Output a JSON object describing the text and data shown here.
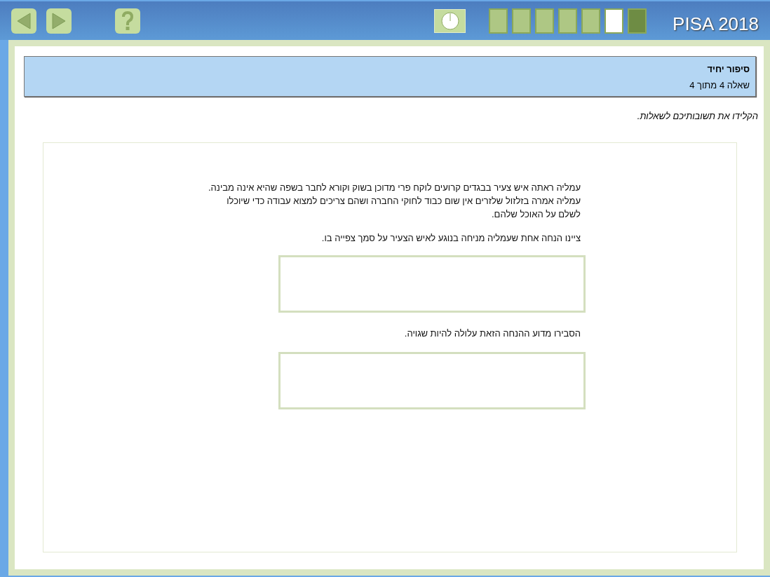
{
  "toolbar": {
    "back_enabled": false,
    "forward_enabled": false,
    "progress": [
      {
        "kind": "done"
      },
      {
        "kind": "done"
      },
      {
        "kind": "done"
      },
      {
        "kind": "done"
      },
      {
        "kind": "done"
      },
      {
        "kind": "current"
      },
      {
        "kind": "todo"
      }
    ],
    "brand": "PISA 2018"
  },
  "unit_header": {
    "title": "סיפור יחיד",
    "subtitle": "שאלה 4 מתוך 4"
  },
  "instruction": "הקלידו את תשובותיכם לשאלות.",
  "stimulus": [
    "עמליה ראתה איש צעיר בבגדים קרועים לוקח פרי מדוכן בשוק וקורא לחבר בשפה שהיא אינה מבינה.",
    "עמליה אמרה בזלזול שלזרים אין שום כבוד לחוקי החברה ושהם צריכים למצוא עבודה כדי שיוכלו לשלם על האוכל שלהם."
  ],
  "questions": [
    {
      "prompt": "ציינו הנחה אחת שעמליה מניחה בנוגע לאיש הצעיר על סמך צפייה בו."
    },
    {
      "prompt": "הסבירו מדוע ההנחה הזאת עלולה להיות שגויה."
    }
  ]
}
